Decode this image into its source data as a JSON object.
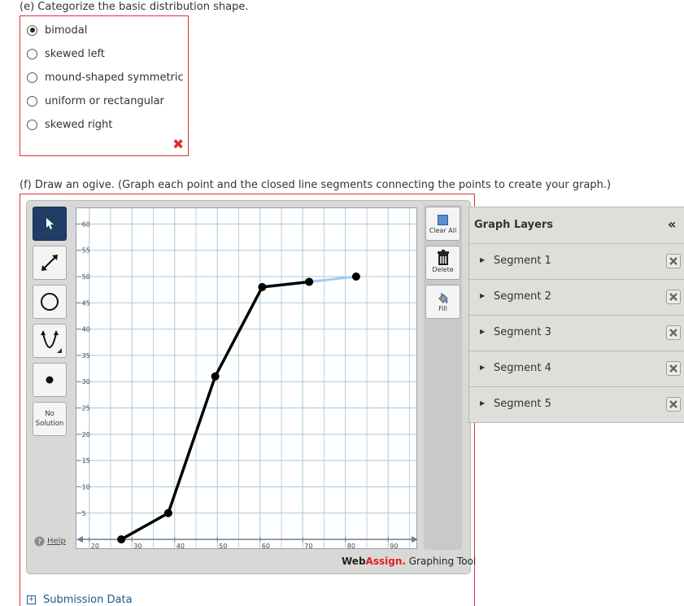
{
  "question_e": {
    "prompt": "(e) Categorize the basic distribution shape.",
    "options": [
      "bimodal",
      "skewed left",
      "mound-shaped symmetric",
      "uniform or rectangular",
      "skewed right"
    ],
    "selected": "bimodal",
    "result": "incorrect"
  },
  "question_f": {
    "prompt": "(f) Draw an ogive. (Graph each point and the closed line segments connecting the points to create your graph.)"
  },
  "toolbar": {
    "no_solution_line1": "No",
    "no_solution_line2": "Solution",
    "help_label": "Help",
    "clear_all_label": "Clear All",
    "delete_label": "Delete",
    "fill_label": "Fill"
  },
  "branding": {
    "web": "WebAssign.",
    "web_prefix": "Web",
    "assign": "Assign.",
    "tool": " Graphing Tool"
  },
  "layers": {
    "title": "Graph Layers",
    "collapse_glyph": "«",
    "items": [
      "Segment 1",
      "Segment 2",
      "Segment 3",
      "Segment 4",
      "Segment 5"
    ]
  },
  "submission": {
    "label": "Submission Data"
  },
  "chart_data": {
    "type": "line",
    "xlim": [
      17,
      97
    ],
    "ylim": [
      -2,
      63
    ],
    "x_ticks": [
      20,
      30,
      40,
      50,
      60,
      70,
      80,
      90
    ],
    "y_ticks": [
      5,
      10,
      15,
      20,
      25,
      30,
      35,
      40,
      45,
      50,
      55,
      60
    ],
    "series": [
      {
        "points": [
          [
            27.5,
            0
          ],
          [
            38.5,
            5
          ],
          [
            49.5,
            31
          ],
          [
            60.5,
            48
          ],
          [
            71.5,
            49
          ],
          [
            82.5,
            50
          ]
        ]
      }
    ],
    "highlighted_segment": 5,
    "colors": {
      "line": "#000000",
      "selected": "#a8c8f0",
      "grid": "#a9c7dc",
      "axis": "#6f7f8c"
    }
  }
}
